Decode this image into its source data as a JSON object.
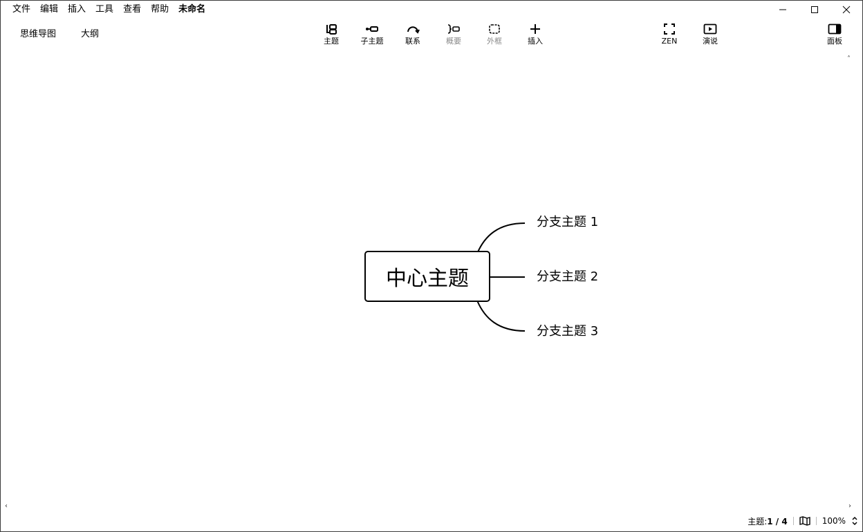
{
  "menu": {
    "items": [
      "文件",
      "编辑",
      "插入",
      "工具",
      "查看",
      "帮助"
    ],
    "doc_title": "未命名"
  },
  "view_tabs": [
    "思维导图",
    "大纲"
  ],
  "toolbar": {
    "topic": "主题",
    "subtopic": "子主题",
    "relationship": "联系",
    "summary": "概要",
    "boundary": "外框",
    "insert": "插入",
    "zen": "ZEN",
    "present": "演说",
    "panel": "面板"
  },
  "map": {
    "central": "中心主题",
    "branches": [
      "分支主题 1",
      "分支主题 2",
      "分支主题 3"
    ]
  },
  "status": {
    "topic_label": "主题:",
    "topic_count": "1 / 4",
    "zoom": "100%"
  },
  "icons": {
    "minimize": "minimize-icon",
    "maximize": "maximize-icon",
    "close": "close-icon",
    "map": "map-icon",
    "zoom_stepper": "updown-chevron-icon"
  }
}
